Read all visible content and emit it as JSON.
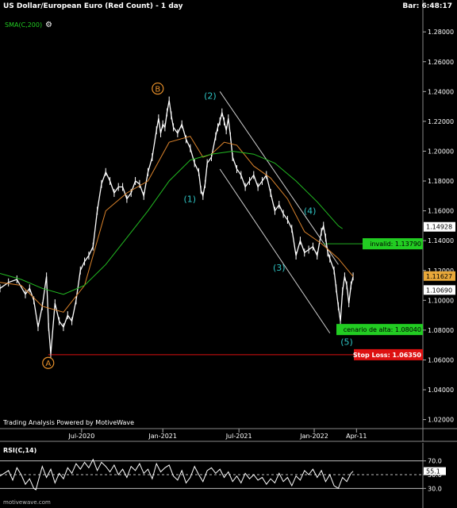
{
  "header": {
    "title": "US Dollar/European Euro (Red Count) - 1 day",
    "bar_time": "Bar: 6:48:17",
    "indicator": "SMA(C,200)",
    "gear_icon": "gear-icon"
  },
  "footer": {
    "powered_by": "Trading Analysis Powered by MotiveWave",
    "watermark": "motivewave.com"
  },
  "rsi_panel": {
    "title": "RSI(C,14)"
  },
  "colors": {
    "background": "#000000",
    "price": "#ffffff",
    "sma": "#22bb22",
    "ema": "#d9822b",
    "wave_labels": "#2ec4c4",
    "abc_labels": "#e8902a",
    "invalid": "#22aa22",
    "target": "#22cc22",
    "stop": "#dd1111"
  },
  "chart_data": [
    {
      "type": "line",
      "title": "US Dollar/European Euro (Red Count) - 1 day",
      "y_ticks": [
        "1.28000",
        "1.26000",
        "1.24000",
        "1.22000",
        "1.20000",
        "1.18000",
        "1.16000",
        "1.14000",
        "1.12000",
        "1.10000",
        "1.08000",
        "1.06000",
        "1.04000",
        "1.02000"
      ],
      "ylim": [
        1.015,
        1.295
      ],
      "x_ticks": [
        "Jul-2020",
        "Jan-2021",
        "Jul-2021",
        "Jan-2022",
        "Apr-11"
      ],
      "x_tick_pos": [
        0.193,
        0.385,
        0.565,
        0.743,
        0.843
      ],
      "series": [
        {
          "name": "price",
          "points": [
            [
              0.0,
              1.108
            ],
            [
              0.02,
              1.112
            ],
            [
              0.04,
              1.114
            ],
            [
              0.06,
              1.104
            ],
            [
              0.07,
              1.108
            ],
            [
              0.08,
              1.1
            ],
            [
              0.09,
              1.082
            ],
            [
              0.1,
              1.096
            ],
            [
              0.11,
              1.116
            ],
            [
              0.115,
              1.082
            ],
            [
              0.12,
              1.064
            ],
            [
              0.13,
              1.098
            ],
            [
              0.14,
              1.086
            ],
            [
              0.15,
              1.082
            ],
            [
              0.16,
              1.09
            ],
            [
              0.17,
              1.086
            ],
            [
              0.18,
              1.1
            ],
            [
              0.19,
              1.12
            ],
            [
              0.2,
              1.126
            ],
            [
              0.21,
              1.13
            ],
            [
              0.22,
              1.136
            ],
            [
              0.23,
              1.16
            ],
            [
              0.24,
              1.178
            ],
            [
              0.25,
              1.186
            ],
            [
              0.26,
              1.18
            ],
            [
              0.27,
              1.172
            ],
            [
              0.28,
              1.176
            ],
            [
              0.29,
              1.176
            ],
            [
              0.3,
              1.168
            ],
            [
              0.31,
              1.172
            ],
            [
              0.32,
              1.18
            ],
            [
              0.33,
              1.178
            ],
            [
              0.34,
              1.17
            ],
            [
              0.35,
              1.186
            ],
            [
              0.36,
              1.196
            ],
            [
              0.37,
              1.214
            ],
            [
              0.375,
              1.222
            ],
            [
              0.38,
              1.212
            ],
            [
              0.385,
              1.218
            ],
            [
              0.39,
              1.216
            ],
            [
              0.395,
              1.226
            ],
            [
              0.4,
              1.234
            ],
            [
              0.405,
              1.224
            ],
            [
              0.41,
              1.216
            ],
            [
              0.42,
              1.212
            ],
            [
              0.43,
              1.218
            ],
            [
              0.44,
              1.208
            ],
            [
              0.45,
              1.202
            ],
            [
              0.46,
              1.192
            ],
            [
              0.47,
              1.186
            ],
            [
              0.475,
              1.174
            ],
            [
              0.48,
              1.17
            ],
            [
              0.485,
              1.178
            ],
            [
              0.49,
              1.192
            ],
            [
              0.5,
              1.196
            ],
            [
              0.51,
              1.21
            ],
            [
              0.515,
              1.216
            ],
            [
              0.52,
              1.22
            ],
            [
              0.525,
              1.226
            ],
            [
              0.53,
              1.22
            ],
            [
              0.535,
              1.214
            ],
            [
              0.54,
              1.222
            ],
            [
              0.545,
              1.21
            ],
            [
              0.55,
              1.196
            ],
            [
              0.56,
              1.188
            ],
            [
              0.57,
              1.184
            ],
            [
              0.58,
              1.176
            ],
            [
              0.59,
              1.18
            ],
            [
              0.6,
              1.184
            ],
            [
              0.61,
              1.176
            ],
            [
              0.62,
              1.18
            ],
            [
              0.63,
              1.184
            ],
            [
              0.64,
              1.172
            ],
            [
              0.65,
              1.16
            ],
            [
              0.66,
              1.164
            ],
            [
              0.67,
              1.158
            ],
            [
              0.68,
              1.154
            ],
            [
              0.69,
              1.148
            ],
            [
              0.7,
              1.13
            ],
            [
              0.71,
              1.14
            ],
            [
              0.72,
              1.132
            ],
            [
              0.73,
              1.134
            ],
            [
              0.74,
              1.136
            ],
            [
              0.75,
              1.13
            ],
            [
              0.76,
              1.146
            ],
            [
              0.765,
              1.15
            ],
            [
              0.77,
              1.142
            ],
            [
              0.775,
              1.132
            ],
            [
              0.78,
              1.128
            ],
            [
              0.79,
              1.12
            ],
            [
              0.795,
              1.108
            ],
            [
              0.8,
              1.096
            ],
            [
              0.805,
              1.086
            ],
            [
              0.81,
              1.106
            ],
            [
              0.815,
              1.116
            ],
            [
              0.82,
              1.11
            ],
            [
              0.825,
              1.098
            ],
            [
              0.83,
              1.11
            ],
            [
              0.835,
              1.116
            ]
          ]
        },
        {
          "name": "ema",
          "points": [
            [
              0.0,
              1.112
            ],
            [
              0.05,
              1.11
            ],
            [
              0.1,
              1.096
            ],
            [
              0.15,
              1.092
            ],
            [
              0.2,
              1.11
            ],
            [
              0.25,
              1.16
            ],
            [
              0.3,
              1.172
            ],
            [
              0.35,
              1.18
            ],
            [
              0.4,
              1.206
            ],
            [
              0.45,
              1.21
            ],
            [
              0.48,
              1.196
            ],
            [
              0.5,
              1.198
            ],
            [
              0.53,
              1.206
            ],
            [
              0.56,
              1.204
            ],
            [
              0.6,
              1.19
            ],
            [
              0.64,
              1.182
            ],
            [
              0.68,
              1.168
            ],
            [
              0.72,
              1.146
            ],
            [
              0.76,
              1.138
            ],
            [
              0.8,
              1.128
            ],
            [
              0.835,
              1.116
            ]
          ]
        },
        {
          "name": "SMA(C,200)",
          "points": [
            [
              0.0,
              1.118
            ],
            [
              0.05,
              1.114
            ],
            [
              0.1,
              1.108
            ],
            [
              0.15,
              1.104
            ],
            [
              0.2,
              1.11
            ],
            [
              0.25,
              1.124
            ],
            [
              0.3,
              1.142
            ],
            [
              0.35,
              1.16
            ],
            [
              0.4,
              1.18
            ],
            [
              0.45,
              1.194
            ],
            [
              0.5,
              1.198
            ],
            [
              0.55,
              1.2
            ],
            [
              0.6,
              1.198
            ],
            [
              0.65,
              1.192
            ],
            [
              0.7,
              1.18
            ],
            [
              0.75,
              1.166
            ],
            [
              0.8,
              1.15
            ],
            [
              0.81,
              1.148
            ]
          ]
        }
      ],
      "channel": [
        [
          [
            0.52,
            1.24
          ],
          [
            0.8,
            1.124
          ]
        ],
        [
          [
            0.52,
            1.188
          ],
          [
            0.78,
            1.078
          ]
        ]
      ],
      "wave_labels": [
        {
          "text": "B",
          "x": 0.373,
          "y": 1.242,
          "style": "abc"
        },
        {
          "text": "A",
          "x": 0.114,
          "y": 1.058,
          "style": "abc"
        },
        {
          "text": "(2)",
          "x": 0.497,
          "y": 1.235,
          "style": "wave"
        },
        {
          "text": "(1)",
          "x": 0.449,
          "y": 1.166,
          "style": "wave"
        },
        {
          "text": "(3)",
          "x": 0.66,
          "y": 1.12,
          "style": "wave"
        },
        {
          "text": "(4)",
          "x": 0.733,
          "y": 1.158,
          "style": "wave"
        },
        {
          "text": "(5)",
          "x": 0.82,
          "y": 1.07,
          "style": "wave"
        }
      ],
      "levels": [
        {
          "name": "invalid",
          "label": "invalid: 1.13790",
          "value": 1.1379,
          "line_from": 0.765
        },
        {
          "name": "target",
          "label": "cenario de alta: 1.08040",
          "value": 1.0804,
          "line_from": 0.8
        },
        {
          "name": "stop",
          "label": "Stop Loss: 1.06350",
          "value": 1.0635,
          "line_from": 0.114
        }
      ],
      "price_tags": [
        {
          "label": "1.14928",
          "value": 1.14928,
          "color": "#ffffff"
        },
        {
          "label": "1.11627",
          "value": 1.11627,
          "color": "#e8a83a"
        },
        {
          "label": "1.10690",
          "value": 1.1069,
          "color": "#ffffff"
        }
      ]
    },
    {
      "type": "line",
      "title": "RSI(C,14)",
      "ylim": [
        20,
        80
      ],
      "y_ticks": [
        "70.0",
        "50.0",
        "30.0"
      ],
      "tag": {
        "label": "55.1",
        "value": 55.1
      },
      "levels": [
        70,
        50,
        30
      ],
      "series": [
        {
          "name": "RSI(C,14)",
          "points": [
            [
              0.0,
              48
            ],
            [
              0.02,
              56
            ],
            [
              0.03,
              42
            ],
            [
              0.04,
              60
            ],
            [
              0.05,
              50
            ],
            [
              0.06,
              36
            ],
            [
              0.07,
              44
            ],
            [
              0.08,
              30
            ],
            [
              0.085,
              28
            ],
            [
              0.09,
              40
            ],
            [
              0.1,
              62
            ],
            [
              0.11,
              46
            ],
            [
              0.12,
              58
            ],
            [
              0.13,
              38
            ],
            [
              0.14,
              52
            ],
            [
              0.15,
              44
            ],
            [
              0.16,
              60
            ],
            [
              0.17,
              52
            ],
            [
              0.18,
              66
            ],
            [
              0.19,
              58
            ],
            [
              0.2,
              68
            ],
            [
              0.21,
              60
            ],
            [
              0.22,
              72
            ],
            [
              0.23,
              56
            ],
            [
              0.24,
              68
            ],
            [
              0.25,
              62
            ],
            [
              0.26,
              54
            ],
            [
              0.27,
              64
            ],
            [
              0.28,
              50
            ],
            [
              0.29,
              58
            ],
            [
              0.3,
              46
            ],
            [
              0.31,
              62
            ],
            [
              0.32,
              56
            ],
            [
              0.33,
              66
            ],
            [
              0.34,
              52
            ],
            [
              0.35,
              58
            ],
            [
              0.36,
              44
            ],
            [
              0.37,
              66
            ],
            [
              0.38,
              54
            ],
            [
              0.39,
              60
            ],
            [
              0.4,
              64
            ],
            [
              0.41,
              48
            ],
            [
              0.42,
              42
            ],
            [
              0.43,
              56
            ],
            [
              0.44,
              38
            ],
            [
              0.45,
              46
            ],
            [
              0.46,
              62
            ],
            [
              0.47,
              50
            ],
            [
              0.48,
              40
            ],
            [
              0.49,
              56
            ],
            [
              0.5,
              60
            ],
            [
              0.51,
              52
            ],
            [
              0.52,
              58
            ],
            [
              0.53,
              46
            ],
            [
              0.54,
              54
            ],
            [
              0.55,
              40
            ],
            [
              0.56,
              48
            ],
            [
              0.57,
              38
            ],
            [
              0.58,
              52
            ],
            [
              0.59,
              44
            ],
            [
              0.6,
              50
            ],
            [
              0.61,
              42
            ],
            [
              0.62,
              46
            ],
            [
              0.63,
              36
            ],
            [
              0.64,
              44
            ],
            [
              0.65,
              38
            ],
            [
              0.66,
              52
            ],
            [
              0.67,
              40
            ],
            [
              0.68,
              46
            ],
            [
              0.69,
              34
            ],
            [
              0.7,
              48
            ],
            [
              0.71,
              42
            ],
            [
              0.72,
              56
            ],
            [
              0.73,
              50
            ],
            [
              0.74,
              58
            ],
            [
              0.75,
              46
            ],
            [
              0.76,
              56
            ],
            [
              0.77,
              40
            ],
            [
              0.78,
              50
            ],
            [
              0.79,
              34
            ],
            [
              0.8,
              30
            ],
            [
              0.81,
              46
            ],
            [
              0.82,
              40
            ],
            [
              0.83,
              52
            ],
            [
              0.835,
              55
            ]
          ]
        }
      ]
    }
  ]
}
